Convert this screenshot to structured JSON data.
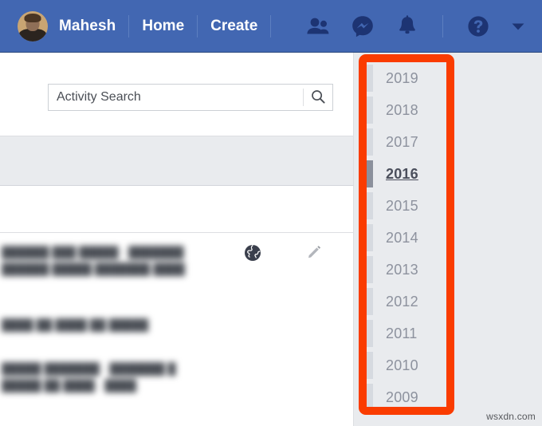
{
  "topnav": {
    "background_color": "#4267b2",
    "profile": {
      "name": "Mahesh",
      "avatar_name": "user-avatar"
    },
    "links": [
      {
        "label": "Home",
        "name": "nav-link-home"
      },
      {
        "label": "Create",
        "name": "nav-link-create"
      }
    ],
    "icons": [
      {
        "name": "friend-requests-icon",
        "label": "Friend Requests"
      },
      {
        "name": "messenger-icon",
        "label": "Messenger"
      },
      {
        "name": "notifications-bell-icon",
        "label": "Notifications"
      },
      {
        "name": "help-question-icon",
        "label": "Help"
      },
      {
        "name": "chevron-down-icon",
        "label": "Account Settings"
      }
    ]
  },
  "search": {
    "value": "Activity Search",
    "placeholder": "Activity Search",
    "button_icon": "search-icon"
  },
  "activity": {
    "story_rows": [
      {
        "text": "██████ ███ █████ · ███████ ██████ █████ ███████ ████",
        "privacy_icon": "globe-public-icon",
        "edit_icon": "pencil-edit-icon"
      },
      {
        "text": "████ ██ ████ ██ █████",
        "privacy_icon": "",
        "edit_icon": ""
      },
      {
        "text": "█████ ███████ · ███████ █ █████ ██ ████ · ████",
        "privacy_icon": "",
        "edit_icon": ""
      }
    ]
  },
  "year_rail": {
    "highlight_border_color": "#fa3c00",
    "selected_year": "2016",
    "years": [
      {
        "label": "2019",
        "selected": false
      },
      {
        "label": "2018",
        "selected": false
      },
      {
        "label": "2017",
        "selected": false
      },
      {
        "label": "2016",
        "selected": true
      },
      {
        "label": "2015",
        "selected": false
      },
      {
        "label": "2014",
        "selected": false
      },
      {
        "label": "2013",
        "selected": false
      },
      {
        "label": "2012",
        "selected": false
      },
      {
        "label": "2011",
        "selected": false
      },
      {
        "label": "2010",
        "selected": false
      },
      {
        "label": "2009",
        "selected": false
      }
    ]
  },
  "watermark": {
    "text": "wsxdn.com"
  }
}
